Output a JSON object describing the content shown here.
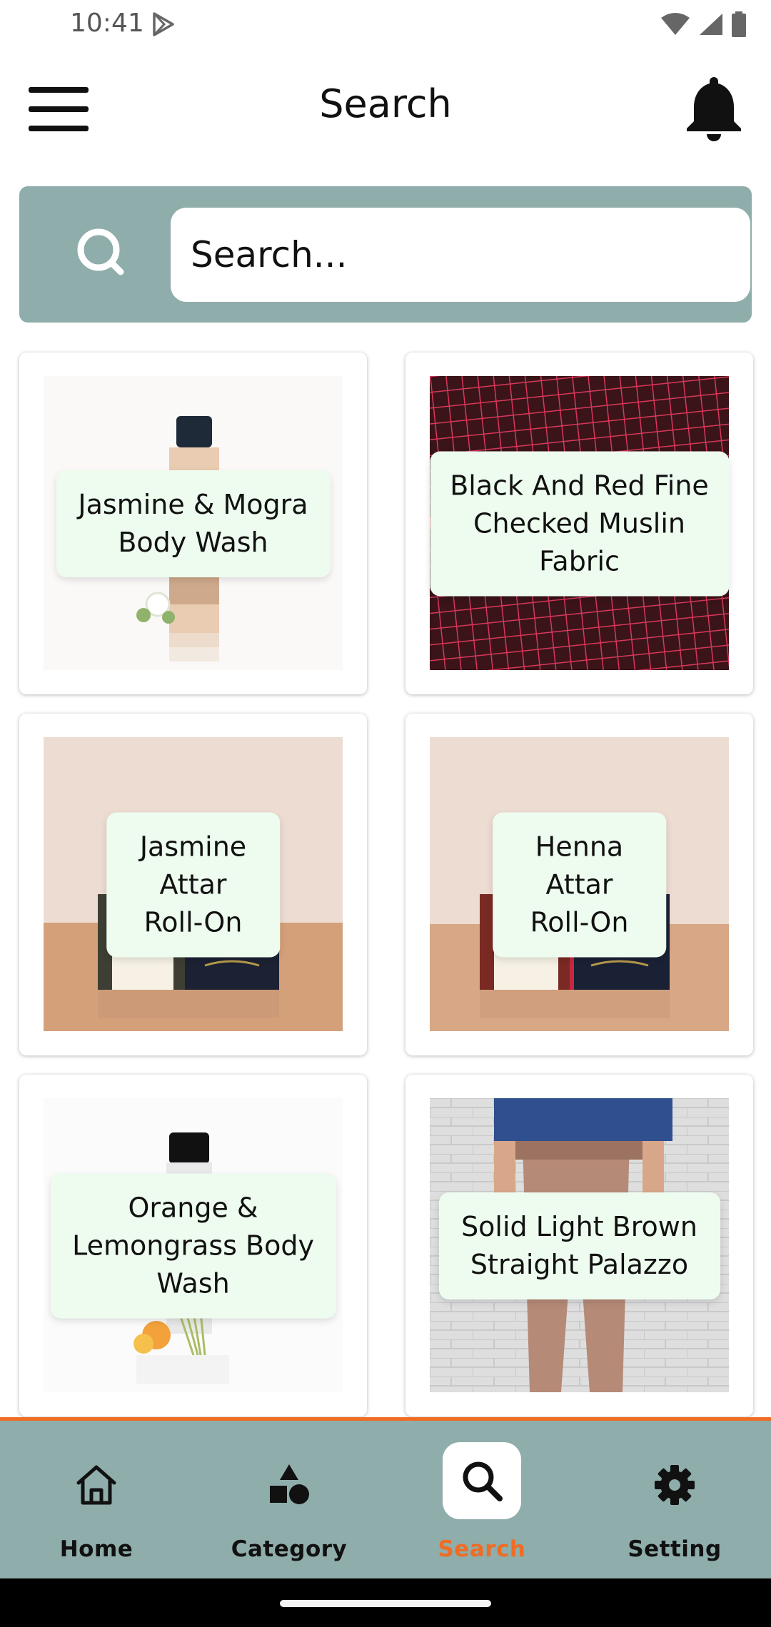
{
  "status_bar": {
    "time": "10:41"
  },
  "header": {
    "title": "Search"
  },
  "search": {
    "placeholder": "Search..."
  },
  "products": [
    {
      "name": "Jasmine & Mogra\nBody Wash"
    },
    {
      "name": "Black And Red Fine\nChecked Muslin\nFabric"
    },
    {
      "name": "Jasmine Attar\nRoll-On"
    },
    {
      "name": "Henna Attar\nRoll-On"
    },
    {
      "name": "Orange &\nLemongrass Body\nWash"
    },
    {
      "name": "Solid Light Brown\nStraight Palazzo"
    }
  ],
  "bottom_nav": {
    "home": "Home",
    "category": "Category",
    "search": "Search",
    "setting": "Setting",
    "active": "search"
  },
  "colors": {
    "accent": "#ef6c25",
    "teal": "#8fadaa",
    "label_bg": "#eefcef"
  }
}
